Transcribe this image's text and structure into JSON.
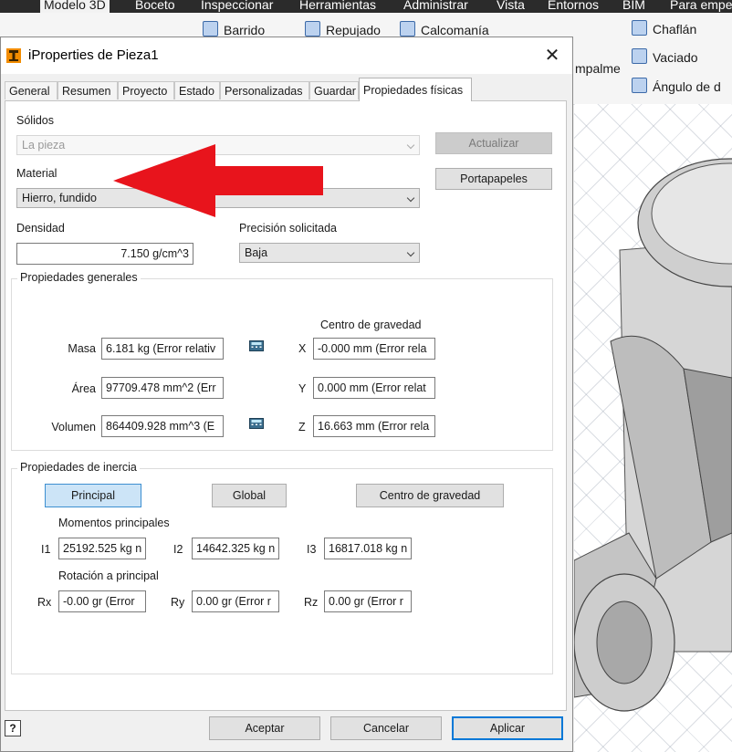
{
  "app": {
    "ribbon_tabs": [
      {
        "label": "Modelo 3D",
        "active": true
      },
      {
        "label": "Boceto"
      },
      {
        "label": "Inspeccionar"
      },
      {
        "label": "Herramientas"
      },
      {
        "label": "Administrar"
      },
      {
        "label": "Vista"
      },
      {
        "label": "Entornos"
      },
      {
        "label": "BIM"
      },
      {
        "label": "Para empe"
      }
    ],
    "ribbon_commands": {
      "barrido": "Barrido",
      "repujado": "Repujado",
      "calcomania": "Calcomanía",
      "empalme": "mpalme",
      "chaflan": "Chaflán",
      "vaciado": "Vaciado",
      "angulo": "Ángulo de d"
    }
  },
  "dialog": {
    "title": "iProperties de Pieza1",
    "tabs": [
      {
        "label": "General"
      },
      {
        "label": "Resumen"
      },
      {
        "label": "Proyecto"
      },
      {
        "label": "Estado"
      },
      {
        "label": "Personalizadas"
      },
      {
        "label": "Guardar"
      },
      {
        "label": "Propiedades físicas",
        "active": true
      }
    ],
    "solidos": {
      "label": "Sólidos",
      "value": "La pieza"
    },
    "actualizar_label": "Actualizar",
    "portapapeles_label": "Portapapeles",
    "material": {
      "label": "Material",
      "value": "Hierro, fundido"
    },
    "densidad": {
      "label": "Densidad",
      "value": "7.150 g/cm^3"
    },
    "precision": {
      "label": "Precisión solicitada",
      "value": "Baja"
    },
    "general": {
      "title": "Propiedades generales",
      "masa": {
        "label": "Masa",
        "value": "6.181 kg (Error relativ"
      },
      "area": {
        "label": "Área",
        "value": "97709.478 mm^2 (Err"
      },
      "volumen": {
        "label": "Volumen",
        "value": "864409.928 mm^3 (E"
      },
      "cog_title": "Centro de gravedad",
      "x": {
        "label": "X",
        "value": "-0.000 mm (Error rela"
      },
      "y": {
        "label": "Y",
        "value": "0.000 mm (Error relat"
      },
      "z": {
        "label": "Z",
        "value": "16.663 mm (Error rela"
      }
    },
    "inertia": {
      "title": "Propiedades de inercia",
      "buttons": {
        "principal": "Principal",
        "global": "Global",
        "centro": "Centro de gravedad"
      },
      "moments_title": "Momentos principales",
      "i1": {
        "label": "I1",
        "value": "25192.525 kg n"
      },
      "i2": {
        "label": "I2",
        "value": "14642.325 kg n"
      },
      "i3": {
        "label": "I3",
        "value": "16817.018 kg n"
      },
      "rotation_title": "Rotación a principal",
      "rx": {
        "label": "Rx",
        "value": "-0.00 gr (Error"
      },
      "ry": {
        "label": "Ry",
        "value": "0.00 gr (Error r"
      },
      "rz": {
        "label": "Rz",
        "value": "0.00 gr (Error r"
      }
    },
    "footer": {
      "help": "?",
      "aceptar": "Aceptar",
      "cancelar": "Cancelar",
      "aplicar": "Aplicar"
    }
  },
  "annotation": {
    "arrow_color": "#e8141c"
  }
}
